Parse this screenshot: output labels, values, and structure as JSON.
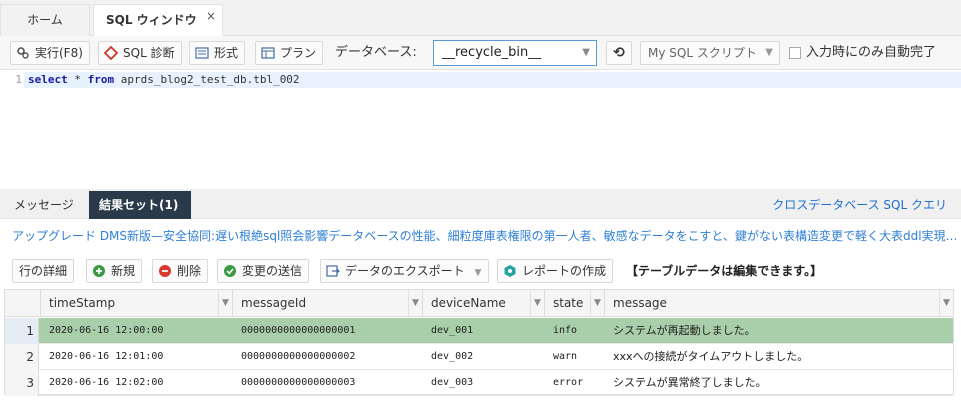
{
  "tabs": {
    "home": "ホーム",
    "sql": "SQL ウィンドウ",
    "close": "×"
  },
  "toolbar": {
    "run": "実行(F8)",
    "diagnose": "SQL 診断",
    "format": "形式",
    "plan": "プラン",
    "db_label": "データベース:",
    "db_value": "__recycle_bin__",
    "script": "My SQL スクリプト",
    "autocomplete": "入力時にのみ自動完了"
  },
  "editor": {
    "line_number": "1",
    "code_select": "select",
    "code_star": " * ",
    "code_from": "from",
    "code_table": " aprds_blog2_test_db.tbl_002"
  },
  "result_tabs": {
    "messages": "メッセージ",
    "resultset": "結果セット(1)",
    "crossdb": "クロスデータベース SQL クエリ"
  },
  "banner": "アップグレード DMS新版—安全協同:遅い根絶sql照会影響データベースの性能、細粒度庫表権限の第一人者、敏感なデータをこすと、鍵がない表構造変更で軽く大表ddl実現…",
  "result_toolbar": {
    "row_detail": "行の詳細",
    "new": "新規",
    "delete": "削除",
    "submit": "変更の送信",
    "export": "データのエクスポート",
    "report": "レポートの作成",
    "note": "【テーブルデータは編集できます。】"
  },
  "grid": {
    "columns": [
      "timeStamp",
      "messageId",
      "deviceName",
      "state",
      "message"
    ],
    "rows": [
      {
        "num": "1",
        "timeStamp": "2020-06-16 12:00:00",
        "messageId": "0000000000000000001",
        "deviceName": "dev_001",
        "state": "info",
        "message": "システムが再起動しました。"
      },
      {
        "num": "2",
        "timeStamp": "2020-06-16 12:01:00",
        "messageId": "0000000000000000002",
        "deviceName": "dev_002",
        "state": "warn",
        "message": "xxxへの接続がタイムアウトしました。"
      },
      {
        "num": "3",
        "timeStamp": "2020-06-16 12:02:00",
        "messageId": "0000000000000000003",
        "deviceName": "dev_003",
        "state": "error",
        "message": "システムが異常終了しました。"
      }
    ]
  },
  "colors": {
    "selected_row": "#a9ceaa",
    "active_tab": "#2b3a4a",
    "link": "#1f6fd1"
  }
}
